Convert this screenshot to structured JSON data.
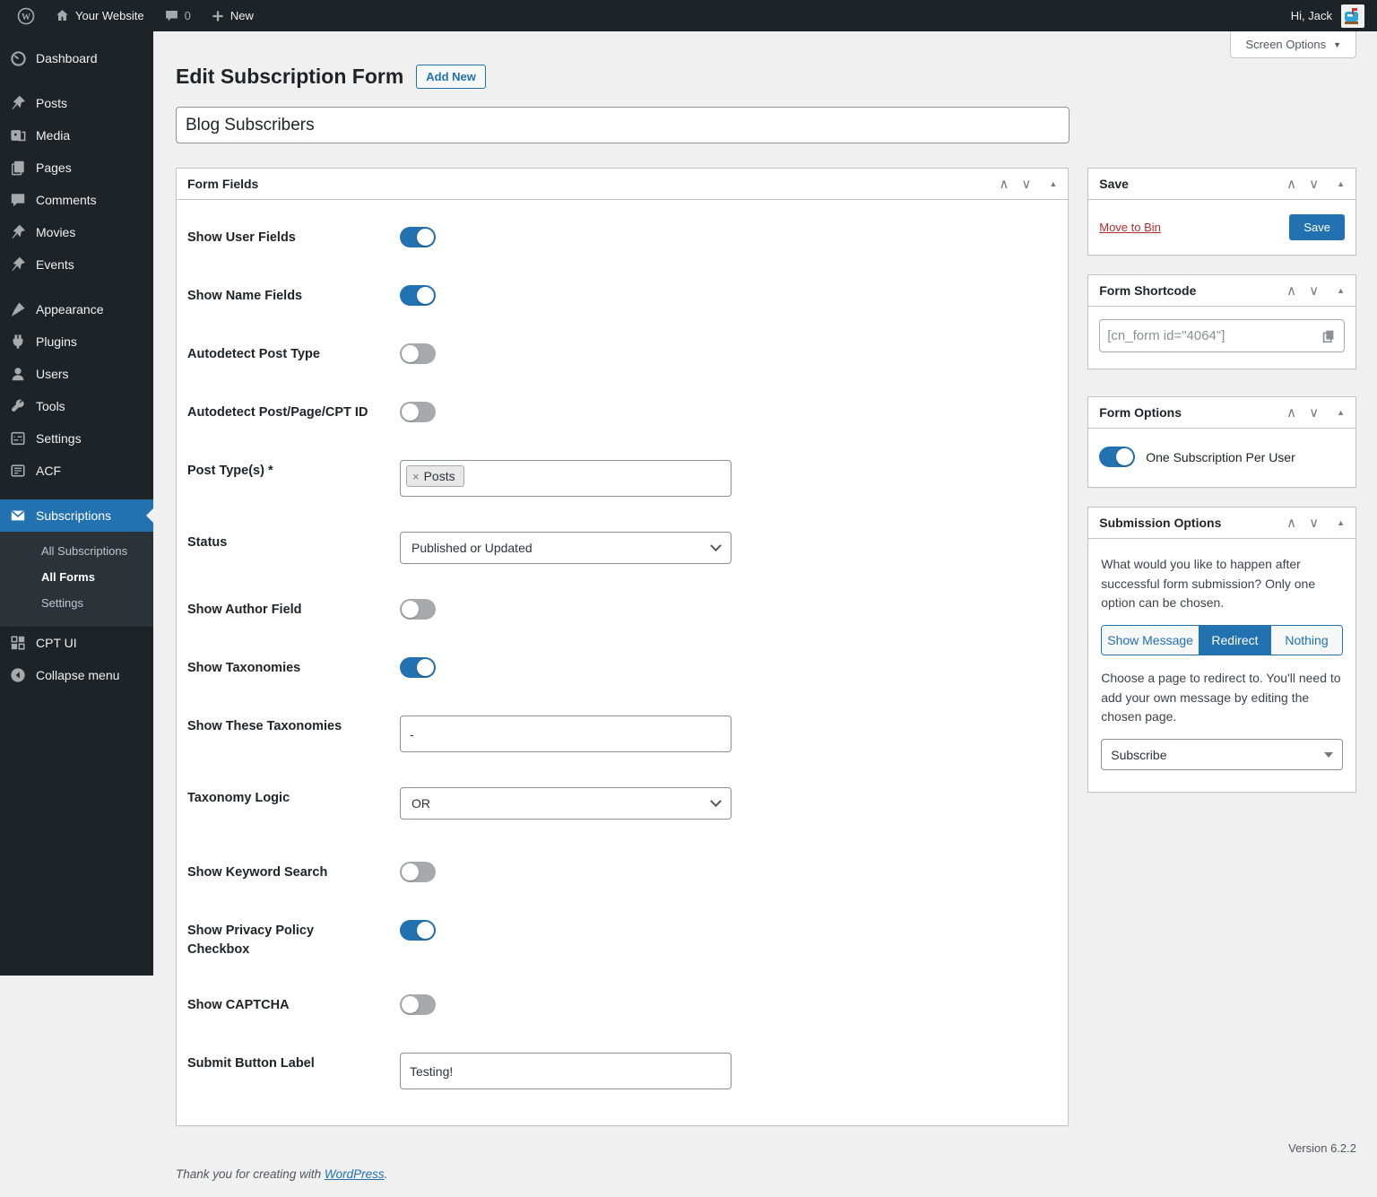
{
  "admin_bar": {
    "site_name": "Your Website",
    "comments_count": "0",
    "new_label": "New",
    "greeting": "Hi, Jack"
  },
  "sidebar": {
    "items": [
      {
        "label": "Dashboard"
      },
      {
        "label": "Posts"
      },
      {
        "label": "Media"
      },
      {
        "label": "Pages"
      },
      {
        "label": "Comments"
      },
      {
        "label": "Movies"
      },
      {
        "label": "Events"
      },
      {
        "label": "Appearance"
      },
      {
        "label": "Plugins"
      },
      {
        "label": "Users"
      },
      {
        "label": "Tools"
      },
      {
        "label": "Settings"
      },
      {
        "label": "ACF"
      },
      {
        "label": "Subscriptions"
      }
    ],
    "subscriptions_submenu": [
      {
        "label": "All Subscriptions"
      },
      {
        "label": "All Forms"
      },
      {
        "label": "Settings"
      }
    ],
    "cpt_ui_label": "CPT UI",
    "collapse_label": "Collapse menu"
  },
  "header": {
    "title": "Edit Subscription Form",
    "add_new_label": "Add New",
    "screen_options_label": "Screen Options"
  },
  "form": {
    "title_value": "Blog Subscribers",
    "panel_title": "Form Fields",
    "fields": [
      {
        "label": "Show User Fields",
        "type": "toggle",
        "state": "on"
      },
      {
        "label": "Show Name Fields",
        "type": "toggle",
        "state": "on"
      },
      {
        "label": "Autodetect Post Type",
        "type": "toggle",
        "state": "off"
      },
      {
        "label": "Autodetect Post/Page/CPT ID",
        "type": "toggle",
        "state": "off"
      },
      {
        "label": "Post Type(s) *",
        "type": "tags",
        "chip": "Posts",
        "remove_glyph": "×"
      },
      {
        "label": "Status",
        "type": "select",
        "value": "Published or Updated"
      },
      {
        "label": "Show Author Field",
        "type": "toggle",
        "state": "off"
      },
      {
        "label": "Show Taxonomies",
        "type": "toggle",
        "state": "on"
      },
      {
        "label": "Show These Taxonomies",
        "type": "text",
        "value": "-"
      },
      {
        "label": "Taxonomy Logic",
        "type": "select",
        "value": "OR"
      },
      {
        "label": "Show Keyword Search",
        "type": "toggle",
        "state": "off"
      },
      {
        "label": "Show Privacy Policy Checkbox",
        "type": "toggle",
        "state": "on"
      },
      {
        "label": "Show CAPTCHA",
        "type": "toggle",
        "state": "off"
      },
      {
        "label": "Submit Button Label",
        "type": "text",
        "value": "Testing!"
      }
    ]
  },
  "right": {
    "save_panel": {
      "title": "Save",
      "move_to_bin": "Move to Bin",
      "save_button": "Save"
    },
    "shortcode_panel": {
      "title": "Form Shortcode",
      "shortcode": "[cn_form id=\"4064\"]"
    },
    "form_options_panel": {
      "title": "Form Options",
      "toggle_label": "One Subscription Per User",
      "toggle_state": "on"
    },
    "submission_panel": {
      "title": "Submission Options",
      "description": "What would you like to happen after successful form submission? Only one option can be chosen.",
      "options": [
        {
          "label": "Show Message"
        },
        {
          "label": "Redirect"
        },
        {
          "label": "Nothing"
        }
      ],
      "selected": "Redirect",
      "redirect_help": "Choose a page to redirect to. You'll need to add your own message by editing the chosen page.",
      "redirect_page": "Subscribe"
    }
  },
  "footer": {
    "thanks_prefix": "Thank you for creating with ",
    "wordpress_link": "WordPress",
    "thanks_suffix": ".",
    "version": "Version 6.2.2"
  },
  "colors": {
    "accent_blue": "#2271b1",
    "danger_red": "#b32d2e",
    "sidebar_dark": "#1d2327",
    "page_bg": "#f0f0f1"
  }
}
